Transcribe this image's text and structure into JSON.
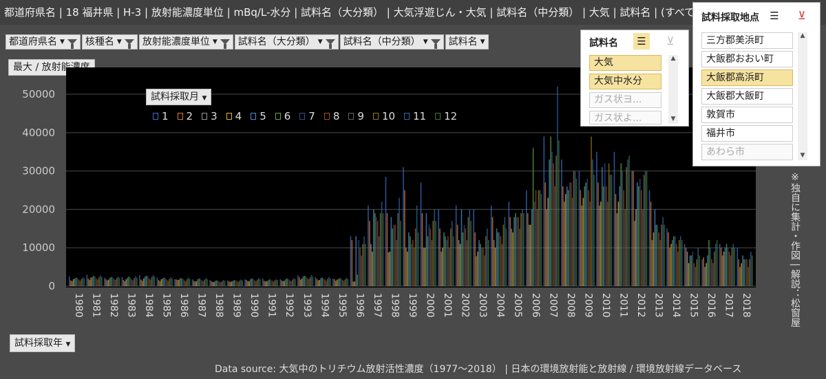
{
  "topbar": {
    "text": "都道府県名 | 18 福井県 | H-3 | 放射能濃度単位 | mBq/L-水分 | 試料名（大分類） | 大気浮遊じん・大気 | 試料名（中分類） | 大気 | 試料名 | (すべて)"
  },
  "filters": [
    "都道府県名",
    "核種名",
    "放射能濃度単位",
    "試料名（大分類）",
    "試料名（中分類）",
    "試料名"
  ],
  "value_button": "最大 / 放射能濃度",
  "legend_button": "試料採取月",
  "axis_button": "試料採取年",
  "slicer_sample": {
    "title": "試料名",
    "items": [
      {
        "label": "大気",
        "state": "selected"
      },
      {
        "label": "大気中水分",
        "state": "selected"
      },
      {
        "label": "ガス状ヨ...",
        "state": "dim"
      },
      {
        "label": "ガス状よ...",
        "state": "dim"
      }
    ]
  },
  "slicer_site": {
    "title": "試料採取地点",
    "items": [
      {
        "label": "三方郡美浜町",
        "state": "normal"
      },
      {
        "label": "大飯郡おおい町",
        "state": "normal"
      },
      {
        "label": "大飯郡高浜町",
        "state": "selected"
      },
      {
        "label": "大飯郡大飯町",
        "state": "normal"
      },
      {
        "label": "敦賀市",
        "state": "normal"
      },
      {
        "label": "福井市",
        "state": "normal"
      },
      {
        "label": "あわら市",
        "state": "dim"
      }
    ]
  },
  "side_note": "※独自に集計・作図 | 解説：松窗屋",
  "source": "Data source: 大気中のトリチウム放射活性濃度（1977～2018） | 日本の環境放射能と放射線 / 環境放射線データベース",
  "colors": {
    "months": [
      "#3d6ec9",
      "#e8792c",
      "#9a9a9a",
      "#e6b71c",
      "#4a8fd6",
      "#5fa943",
      "#2d4f95",
      "#a04e1e",
      "#636363",
      "#9c7812",
      "#2f6aa8",
      "#3e7a2d"
    ]
  },
  "chart_data": {
    "type": "bar",
    "title": "",
    "xlabel": "",
    "ylabel": "",
    "ylim": [
      0,
      57000
    ],
    "yticks": [
      0,
      10000,
      20000,
      30000,
      40000,
      50000
    ],
    "grid": true,
    "legend_position": "top-left",
    "categories": [
      "1980",
      "1981",
      "1982",
      "1983",
      "1984",
      "1985",
      "1986",
      "1987",
      "1988",
      "1989",
      "1990",
      "1991",
      "1992",
      "1993",
      "1994",
      "1995",
      "1996",
      "1997",
      "1998",
      "1999",
      "2000",
      "2001",
      "2002",
      "2003",
      "2004",
      "2005",
      "2006",
      "2007",
      "2008",
      "2009",
      "2010",
      "2011",
      "2012",
      "2013",
      "2014",
      "2015",
      "2016",
      "2017",
      "2018"
    ],
    "series": [
      {
        "name": "1",
        "values": [
          2500,
          3000,
          2200,
          2400,
          2800,
          2200,
          1800,
          1800,
          1600,
          1500,
          1800,
          2000,
          1800,
          2800,
          2300,
          2000,
          13000,
          21000,
          28500,
          31000,
          27000,
          20000,
          21000,
          20000,
          21000,
          22000,
          25000,
          39000,
          33000,
          30000,
          35000,
          35000,
          30000,
          25000,
          15000,
          11000,
          7000,
          11000,
          10000
        ]
      },
      {
        "name": "2",
        "values": [
          1500,
          2000,
          1800,
          1600,
          1700,
          1600,
          1800,
          1400,
          1300,
          1300,
          1600,
          1400,
          1500,
          2300,
          1900,
          1800,
          12000,
          17000,
          19000,
          25000,
          19000,
          15000,
          16000,
          14000,
          18000,
          18000,
          19000,
          27000,
          26000,
          25000,
          27000,
          24000,
          30000,
          22000,
          14000,
          10000,
          7500,
          10000,
          7000
        ]
      },
      {
        "name": "3",
        "values": [
          1300,
          1600,
          1500,
          1300,
          1400,
          1300,
          1600,
          1200,
          1100,
          1100,
          1300,
          1200,
          1300,
          1700,
          1500,
          1400,
          1200,
          11000,
          8800,
          10000,
          10000,
          9000,
          12000,
          7800,
          12000,
          15000,
          16000,
          20000,
          22000,
          21000,
          21000,
          19000,
          17000,
          12000,
          10000,
          9000,
          5000,
          8000,
          5000
        ]
      },
      {
        "name": "4",
        "values": [
          1800,
          2200,
          1700,
          1800,
          2000,
          1800,
          1700,
          1300,
          1100,
          1200,
          1300,
          1300,
          1400,
          2000,
          1600,
          1700,
          1200,
          9000,
          9000,
          9000,
          10000,
          10000,
          11000,
          9000,
          10000,
          14000,
          16000,
          23000,
          24000,
          23000,
          22000,
          22000,
          20000,
          14000,
          11000,
          6000,
          6000,
          9000,
          6000
        ]
      },
      {
        "name": "5",
        "values": [
          2000,
          2400,
          2200,
          2200,
          2500,
          2000,
          2100,
          1800,
          1400,
          1400,
          1800,
          1500,
          1800,
          2600,
          2100,
          1900,
          13000,
          20000,
          18000,
          14000,
          19000,
          14000,
          20000,
          12000,
          15000,
          18000,
          20000,
          33000,
          26000,
          26000,
          31000,
          26000,
          27000,
          20000,
          12000,
          8000,
          8000,
          10000,
          8000
        ]
      },
      {
        "name": "6",
        "values": [
          2200,
          2700,
          2400,
          2500,
          2700,
          2200,
          2000,
          2000,
          1500,
          1600,
          2000,
          1800,
          2000,
          2700,
          2200,
          2100,
          3000,
          19000,
          15000,
          13000,
          13000,
          13000,
          14000,
          11000,
          14000,
          19000,
          36000,
          39000,
          25000,
          27000,
          26000,
          32000,
          26000,
          16000,
          13000,
          8000,
          12000,
          11000,
          7000
        ]
      },
      {
        "name": "7",
        "values": [
          2100,
          2500,
          2300,
          2300,
          2600,
          2100,
          1900,
          1900,
          1400,
          1500,
          1900,
          1600,
          1900,
          2500,
          2000,
          2000,
          12000,
          18000,
          16000,
          11000,
          16000,
          12000,
          16000,
          10000,
          14000,
          18000,
          22000,
          35000,
          27000,
          28000,
          32000,
          30000,
          28000,
          16000,
          13000,
          9000,
          10000,
          10000,
          7000
        ]
      },
      {
        "name": "8",
        "values": [
          1700,
          2000,
          1900,
          1800,
          2000,
          1700,
          1500,
          1500,
          1200,
          1300,
          1500,
          1400,
          1500,
          2100,
          1700,
          1600,
          10000,
          17000,
          16000,
          12000,
          15000,
          13000,
          15000,
          10000,
          13000,
          18000,
          25000,
          32000,
          27000,
          25000,
          26000,
          25000,
          25000,
          14000,
          11000,
          6000,
          7000,
          9000,
          7000
        ]
      },
      {
        "name": "9",
        "values": [
          1400,
          1700,
          1600,
          1500,
          1700,
          1400,
          1300,
          1300,
          1000,
          1100,
          1300,
          1200,
          1300,
          1800,
          1400,
          1400,
          8000,
          13000,
          12000,
          10000,
          12000,
          10000,
          12000,
          8000,
          11000,
          15000,
          20000,
          26000,
          23000,
          22000,
          22000,
          20000,
          20000,
          12000,
          9000,
          5000,
          6000,
          8000,
          5000
        ]
      },
      {
        "name": "10",
        "values": [
          1900,
          2300,
          2100,
          2100,
          2400,
          1900,
          1800,
          1700,
          1300,
          1400,
          1700,
          1500,
          1700,
          2300,
          1900,
          1800,
          11000,
          19000,
          19000,
          15000,
          17000,
          15000,
          18000,
          13000,
          16000,
          19000,
          25000,
          34000,
          30000,
          39000,
          32000,
          31000,
          29000,
          16000,
          12000,
          7000,
          9000,
          10000,
          7000
        ]
      },
      {
        "name": "11",
        "values": [
          2300,
          2800,
          2500,
          2600,
          2900,
          2300,
          2200,
          2100,
          1600,
          1700,
          2100,
          1800,
          2100,
          2900,
          2400,
          2200,
          13000,
          22000,
          23000,
          21000,
          20000,
          17000,
          20000,
          15000,
          18000,
          20000,
          25000,
          52000,
          30000,
          33000,
          29000,
          33000,
          30000,
          18000,
          13000,
          10000,
          11000,
          11000,
          9000
        ]
      },
      {
        "name": "12",
        "values": [
          2000,
          2400,
          2200,
          2200,
          2500,
          2000,
          1900,
          1800,
          1400,
          1500,
          1800,
          1600,
          1800,
          2500,
          2000,
          1900,
          11000,
          19000,
          17000,
          14000,
          17000,
          13000,
          17000,
          12000,
          15000,
          19000,
          24000,
          38000,
          28000,
          29000,
          29000,
          34000,
          30000,
          16000,
          12000,
          8000,
          12000,
          10000,
          8000
        ]
      }
    ]
  }
}
